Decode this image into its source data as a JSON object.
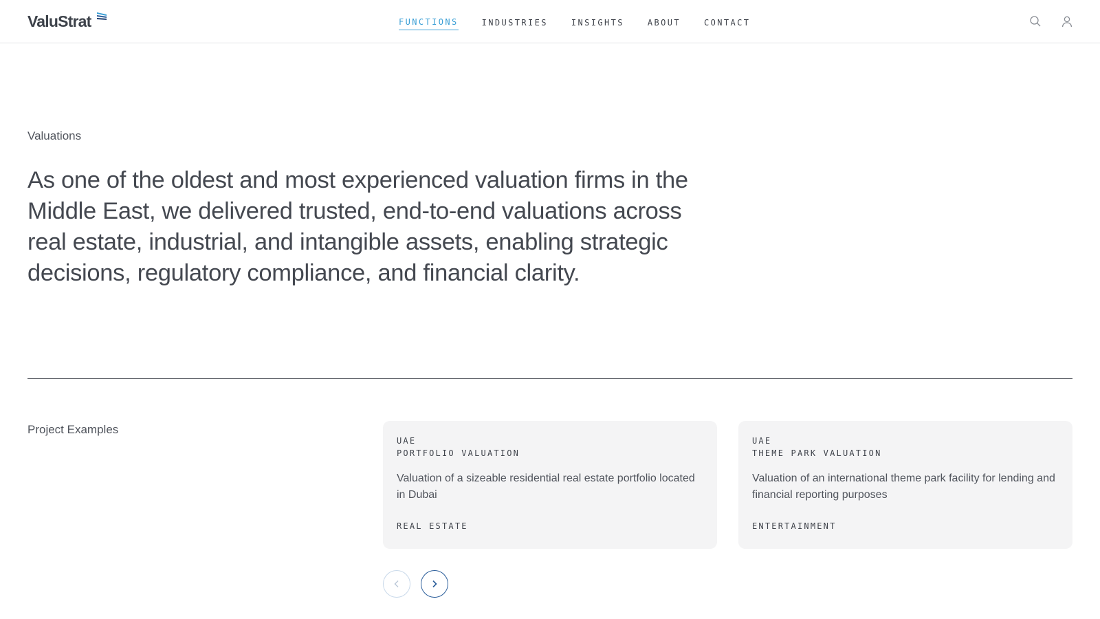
{
  "header": {
    "logo_text": "ValuStrat",
    "nav": [
      {
        "label": "FUNCTIONS",
        "active": true
      },
      {
        "label": "INDUSTRIES",
        "active": false
      },
      {
        "label": "INSIGHTS",
        "active": false
      },
      {
        "label": "ABOUT",
        "active": false
      },
      {
        "label": "CONTACT",
        "active": false
      }
    ],
    "icons": [
      "search-icon",
      "user-icon"
    ]
  },
  "hero": {
    "eyebrow": "Valuations",
    "text": "As one of the oldest and most experienced valuation firms in the Middle East, we delivered trusted, end-to-end valuations across real estate, industrial, and intangible assets, enabling strategic decisions, regulatory compliance, and financial clarity."
  },
  "projects": {
    "label": "Project Examples",
    "cards": [
      {
        "region": "UAE",
        "type": "PORTFOLIO VALUATION",
        "description": "Valuation of a sizeable residential real estate portfolio located in Dubai",
        "tag": "REAL ESTATE"
      },
      {
        "region": "UAE",
        "type": "THEME PARK VALUATION",
        "description": "Valuation of an international theme park facility for lending and financial reporting purposes",
        "tag": "ENTERTAINMENT"
      }
    ],
    "controls": [
      "chevron-left-icon",
      "chevron-right-icon"
    ]
  },
  "colors": {
    "accent": "#3a9fd6",
    "brand_navy": "#2a5d9a",
    "text": "#3f434b",
    "card_bg": "#f4f4f5"
  }
}
